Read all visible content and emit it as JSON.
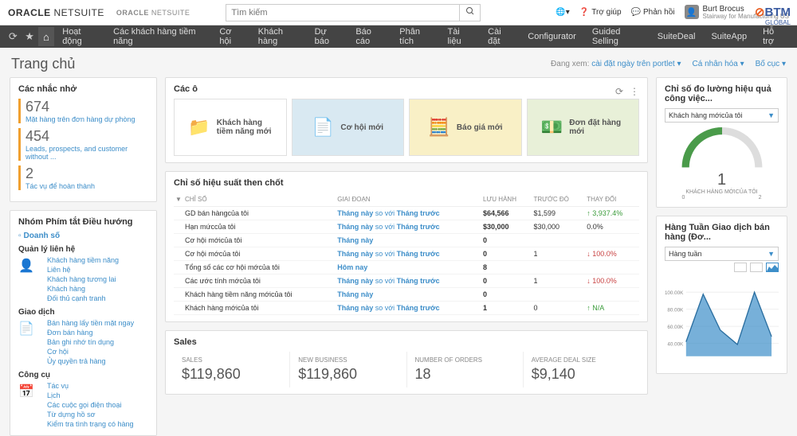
{
  "header": {
    "logo1": "ORACLE NETSUITE",
    "logo2": "ORACLE NETSUITE",
    "search_placeholder": "Tìm kiếm",
    "help": "Trợ giúp",
    "feedback": "Phản hồi",
    "user_name": "Burt Brocus",
    "user_sub": "Stairway for Manufacturing US",
    "btm": "BTM GLOBAL"
  },
  "nav": [
    "Hoạt động",
    "Các khách hàng tiềm năng",
    "Cơ hội",
    "Khách hàng",
    "Dự báo",
    "Báo cáo",
    "Phân tích",
    "Tài liệu",
    "Cài đặt",
    "Configurator",
    "Guided Selling",
    "SuiteDeal",
    "SuiteApp",
    "Hỗ trợ"
  ],
  "page": {
    "title": "Trang chủ",
    "viewing_label": "Đang xem:",
    "viewing_value": "cài đặt ngày trên portlet",
    "personalize": "Cá nhân hóa",
    "layout": "Bố cục"
  },
  "reminders": {
    "title": "Các nhắc nhở",
    "items": [
      {
        "num": "674",
        "text": "Mặt hàng trên đơn hàng dự phòng"
      },
      {
        "num": "454",
        "text": "Leads, prospects, and customer without ..."
      },
      {
        "num": "2",
        "text": "Tác vụ để hoàn thành"
      }
    ]
  },
  "shortcuts": {
    "title": "Nhóm Phím tắt Điều hướng",
    "section": "Doanh số",
    "groups": [
      {
        "head": "Quản lý liên hệ",
        "items": [
          "Khách hàng tiềm năng",
          "Liên hệ",
          "Khách hàng tương lai",
          "Khách hàng",
          "Đối thủ cạnh tranh"
        ]
      },
      {
        "head": "Giao dịch",
        "items": [
          "Bán hàng lấy tiền mặt ngay",
          "Đơn bán hàng",
          "Bản ghi nhớ tín dụng",
          "Cơ hội",
          "Ủy quyền trả hàng"
        ]
      },
      {
        "head": "Công cụ",
        "items": [
          "Tác vụ",
          "Lịch",
          "Các cuộc gọi điện thoại",
          "Từ dựng hồ sơ",
          "Kiểm tra tình trạng có hàng"
        ]
      }
    ]
  },
  "tiles": {
    "title": "Các ô",
    "items": [
      {
        "label": "Khách hàng tiềm năng mới"
      },
      {
        "label": "Cơ hội mới"
      },
      {
        "label": "Báo giá mới"
      },
      {
        "label": "Đơn đặt hàng mới"
      }
    ]
  },
  "kpi": {
    "title": "Chỉ số hiệu suất then chốt",
    "cols": [
      "CHỈ SỐ",
      "GIAI ĐOẠN",
      "LƯU HÀNH",
      "TRƯỚC ĐÓ",
      "THAY ĐỔI"
    ],
    "rows": [
      {
        "name": "GD bán hàngcủa tôi",
        "period": "Tháng này so với Tháng trước",
        "cur": "$64,566",
        "prev": "$1,599",
        "chg": "3,937.4%",
        "dir": "up"
      },
      {
        "name": "Hạn mứccủa tôi",
        "period": "Tháng này so với Tháng trước",
        "cur": "$30,000",
        "prev": "$30,000",
        "chg": "0.0%",
        "dir": ""
      },
      {
        "name": "Cơ hội mớicủa tôi",
        "period": "Tháng này",
        "cur": "0",
        "prev": "",
        "chg": "",
        "dir": ""
      },
      {
        "name": "Cơ hội mớcủa tôi",
        "period": "Tháng này so với Tháng trước",
        "cur": "0",
        "prev": "1",
        "chg": "100.0%",
        "dir": "down"
      },
      {
        "name": "Tổng số các cơ hội mớcủa tôi",
        "period": "Hôm nay",
        "cur": "8",
        "prev": "",
        "chg": "",
        "dir": ""
      },
      {
        "name": "Các ước tính mớcủa tôi",
        "period": "Tháng này so với Tháng trước",
        "cur": "0",
        "prev": "1",
        "chg": "100.0%",
        "dir": "down"
      },
      {
        "name": "Khách hàng tiềm năng mớicủa tôi",
        "period": "Tháng này",
        "cur": "0",
        "prev": "",
        "chg": "",
        "dir": ""
      },
      {
        "name": "Khách hàng mớicủa tôi",
        "period": "Tháng này so với Tháng trước",
        "cur": "1",
        "prev": "0",
        "chg": "N/A",
        "dir": "up"
      }
    ]
  },
  "sales": {
    "title": "Sales",
    "cells": [
      {
        "label": "SALES",
        "val": "$119,860"
      },
      {
        "label": "NEW BUSINESS",
        "val": "$119,860"
      },
      {
        "label": "NUMBER OF ORDERS",
        "val": "18"
      },
      {
        "label": "AVERAGE DEAL SIZE",
        "val": "$9,140"
      }
    ]
  },
  "meter": {
    "title": "Chỉ số đo lường hiệu quả công việc...",
    "dropdown": "Khách hàng mớicủa tôi",
    "value": "1",
    "label": "KHÁCH HÀNG MỚICỦA TÔI",
    "scale_min": "0",
    "scale_max": "2"
  },
  "trend": {
    "title": "Hàng Tuần Giao dịch bán hàng (Đơ...",
    "dropdown": "Hàng tuần"
  },
  "chart_data": {
    "type": "area",
    "y_ticks": [
      100000,
      80000,
      60000,
      40000
    ],
    "y_labels": [
      "100.00K",
      "80.00K",
      "60.00K",
      "40.00K"
    ],
    "series": [
      {
        "name": "sales",
        "values": [
          22000,
          95000,
          40000,
          18000,
          98000,
          30000
        ]
      }
    ]
  }
}
